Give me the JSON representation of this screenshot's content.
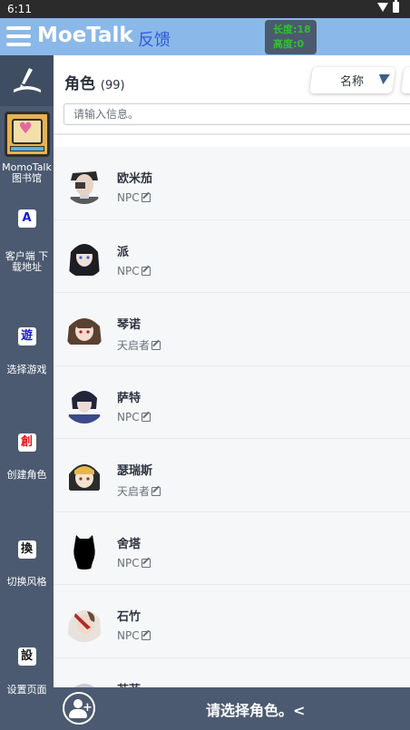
{
  "status_bar": {
    "time": "6:11"
  },
  "header": {
    "app_title": "MoeTalk",
    "feedback_label": "反馈",
    "debug_line1": "长度:18",
    "debug_line2": "高度:0"
  },
  "sidebar": {
    "items": [
      {
        "badge": "",
        "label": "MomoTalk",
        "label2": "图书馆"
      },
      {
        "badge": "A",
        "label": "客户端 下",
        "label2": "载地址",
        "badge_color": "#1a1ad0"
      },
      {
        "badge": "遊",
        "label": "选择游戏",
        "label2": "",
        "badge_color": "#1a1ad0"
      },
      {
        "badge": "創",
        "label": "创建角色",
        "label2": "",
        "badge_color": "#e01818"
      },
      {
        "badge": "換",
        "label": "切换风格",
        "label2": "",
        "badge_color": "#1a1a1a"
      },
      {
        "badge": "設",
        "label": "设置页面",
        "label2": "",
        "badge_color": "#1a1a1a"
      }
    ]
  },
  "main": {
    "title": "角色",
    "count": "(99)",
    "sort_label": "名称",
    "search_placeholder": "请输入信息。"
  },
  "characters": [
    {
      "name": "欧米茄",
      "tag": "NPC",
      "avatar": "omega"
    },
    {
      "name": "派",
      "tag": "NPC",
      "avatar": "pai"
    },
    {
      "name": "琴诺",
      "tag": "天启者",
      "avatar": "qinnuo"
    },
    {
      "name": "萨特",
      "tag": "NPC",
      "avatar": "sate"
    },
    {
      "name": "瑟瑞斯",
      "tag": "天启者",
      "avatar": "seruisi"
    },
    {
      "name": "舍塔",
      "tag": "NPC",
      "avatar": "sheta"
    },
    {
      "name": "石竹",
      "tag": "NPC",
      "avatar": "shizhu"
    },
    {
      "name": "苏菲",
      "tag": "",
      "avatar": "sufei"
    }
  ],
  "bottom_bar": {
    "prompt": "请选择角色。<"
  },
  "colors": {
    "header": "#8ab8e8",
    "sidebar": "#4b5a70",
    "feedback": "#2f5bd6",
    "debug_text": "#30c030"
  }
}
